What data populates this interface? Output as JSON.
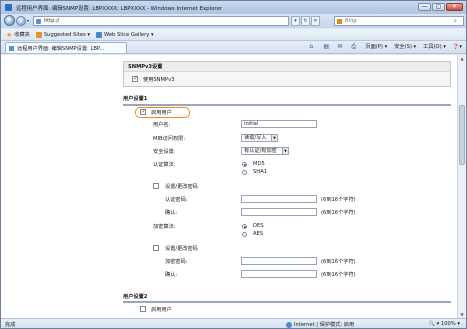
{
  "window": {
    "title": "远程用户界面: 编辑SNMP设置: LBPXXXX: LBPXXXX - Windows Internet Explorer",
    "min_label": "—",
    "max_label": "▢",
    "close_label": "✕"
  },
  "address": {
    "url": "http://",
    "search_placeholder": "Bing",
    "stop_label": "✕",
    "refresh_label": "↻",
    "feed_label": "▾"
  },
  "favorites": {
    "favorites_label": "收藏夹",
    "items": [
      {
        "label": "Suggested Sites ▾",
        "icon": "suggested-sites-icon"
      },
      {
        "label": "Web Slice Gallery ▾",
        "icon": "web-slice-icon"
      }
    ]
  },
  "tab": {
    "label": "远程用户界面: 编辑SNMP设置: LBP..."
  },
  "commandbar": {
    "page_label": "页面(P) ▾",
    "safety_label": "安全(S) ▾",
    "tools_label": "工具(O) ▾",
    "help_label": "❓▾"
  },
  "snmpv3_section": {
    "header": "SNMPv3设置",
    "use_snmpv3_label": "使用SNMPv3",
    "use_snmpv3_checked": true
  },
  "user1": {
    "heading": "用户设置1",
    "enable_label": "启用用户",
    "enable_checked": true,
    "username_label": "用户名:",
    "username_value": "initial",
    "access_label": "MIB访问权限:",
    "access_value": "读取/写入",
    "security_label": "安全设置:",
    "security_value": "有认证/有加密",
    "auth_algo_label": "认证算法:",
    "auth_algo_options": [
      "MD5",
      "SHA1"
    ],
    "auth_algo_selected": "MD5",
    "set_auth_pw_label": "设置/更改密码",
    "auth_pw_label": "认证密码:",
    "auth_pw_hint": "(6到16个字符)",
    "confirm_label": "确认:",
    "confirm_hint": "(6到16个字符)",
    "enc_algo_label": "加密算法:",
    "enc_algo_options": [
      "DES",
      "AES"
    ],
    "enc_algo_selected": "DES",
    "set_enc_pw_label": "设置/更改密码",
    "enc_pw_label": "加密密码:",
    "enc_pw_hint": "(6到16个字符)",
    "confirm2_label": "确认:",
    "confirm2_hint": "(6到16个字符)"
  },
  "user2": {
    "heading": "用户设置2",
    "enable_label": "启用用户"
  },
  "status": {
    "left_text": "完成",
    "zone_text": "Internet | 保护模式: 启用",
    "zoom_text": "🔍 ▾ 100% ▾"
  },
  "colors": {
    "highlight": "#f08a1c",
    "section_rule": "#9aa7b8"
  }
}
